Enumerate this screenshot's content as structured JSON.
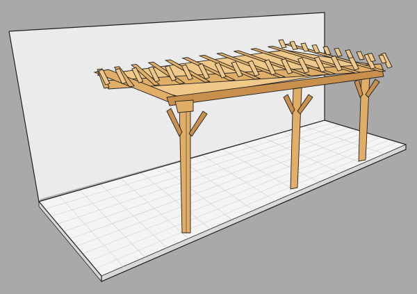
{
  "scene": {
    "subject": "pergola-3d-render",
    "colors": {
      "background": "#a9a9a9",
      "wall": "#ebebeb",
      "wall_edge": "#c8c8c8",
      "floor": "#f4f4f4",
      "floor_grid": "#cfcfcf",
      "floor_side": "#d8d8d8",
      "wood_light": "#f0c98a",
      "wood_mid": "#e0ae67",
      "wood_dark": "#c98f4c",
      "outline": "#1e1e1e"
    }
  }
}
